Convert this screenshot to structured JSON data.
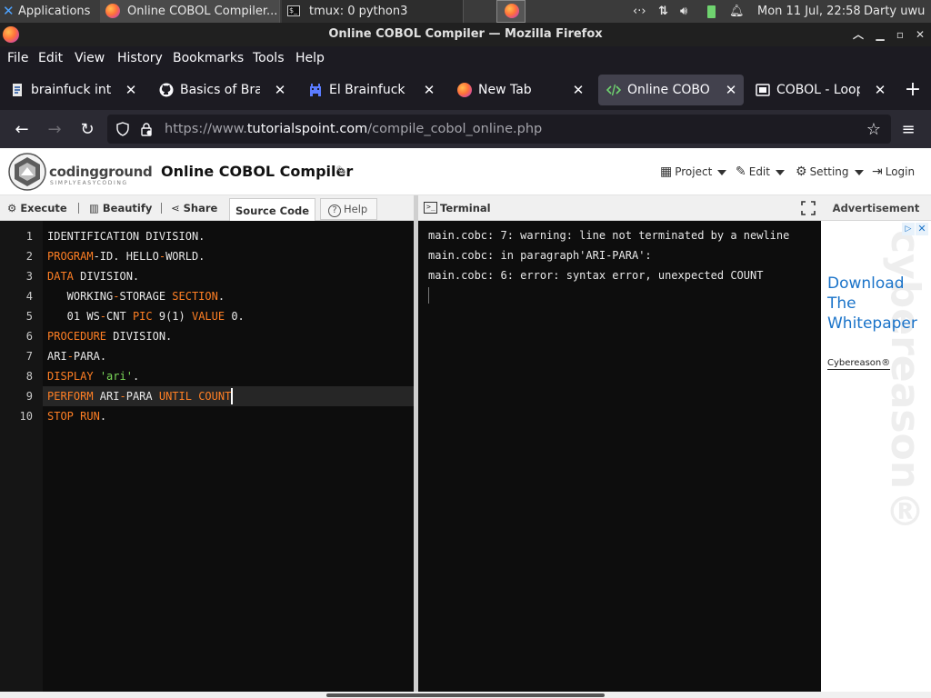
{
  "os_panel": {
    "apps_label": "Applications",
    "tasks": [
      "Online COBOL Compiler...",
      "tmux: 0 python3"
    ],
    "clock": "Mon 11 Jul, 22:58",
    "user": "Darty uwu"
  },
  "window": {
    "title": "Online COBOL Compiler — Mozilla Firefox"
  },
  "menubar": [
    "File",
    "Edit",
    "View",
    "History",
    "Bookmarks",
    "Tools",
    "Help"
  ],
  "tabs": [
    {
      "label": "brainfuck interp",
      "icon": "document-icon"
    },
    {
      "label": "Basics of BrainF",
      "icon": "github-icon"
    },
    {
      "label": "El Brainfuck",
      "icon": "invader-icon"
    },
    {
      "label": "New Tab",
      "icon": "firefox-icon"
    },
    {
      "label": "Online COBOL C",
      "icon": "code-icon",
      "active": true
    },
    {
      "label": "COBOL - Loop S",
      "icon": "tutorialspoint-icon"
    }
  ],
  "url": {
    "prefix": "https://www.",
    "domain": "tutorialspoint.com",
    "path": "/compile_cobol_online.php"
  },
  "site": {
    "logo_text": "codingground",
    "logo_sub": "SIMPLYEASYCODING",
    "page_title": "Online COBOL Compiler",
    "menu": {
      "project": "Project",
      "edit": "Edit",
      "setting": "Setting",
      "login": "Login"
    }
  },
  "toolbar": {
    "execute": "Execute",
    "beautify": "Beautify",
    "share": "Share",
    "source_code": "Source Code",
    "help": "Help"
  },
  "editor": {
    "active_line": 9,
    "lines": [
      [
        {
          "t": "IDENTIFICATION DIVISION."
        }
      ],
      [
        {
          "t": "PROGRAM",
          "c": "kw"
        },
        {
          "t": "-ID. HELLO"
        },
        {
          "t": "-",
          "c": "kw"
        },
        {
          "t": "WORLD."
        }
      ],
      [
        {
          "t": "DATA",
          "c": "kw"
        },
        {
          "t": " DIVISION."
        }
      ],
      [
        {
          "t": "   WORKING"
        },
        {
          "t": "-",
          "c": "kw"
        },
        {
          "t": "STORAGE "
        },
        {
          "t": "SECTION",
          "c": "kw"
        },
        {
          "t": "."
        }
      ],
      [
        {
          "t": "   01 WS"
        },
        {
          "t": "-",
          "c": "kw"
        },
        {
          "t": "CNT "
        },
        {
          "t": "PIC",
          "c": "kw"
        },
        {
          "t": " 9(1) "
        },
        {
          "t": "VALUE",
          "c": "kw"
        },
        {
          "t": " 0."
        }
      ],
      [
        {
          "t": "PROCEDURE",
          "c": "kw"
        },
        {
          "t": " DIVISION."
        }
      ],
      [
        {
          "t": "ARI"
        },
        {
          "t": "-",
          "c": "kw"
        },
        {
          "t": "PARA."
        }
      ],
      [
        {
          "t": "DISPLAY",
          "c": "kw"
        },
        {
          "t": " "
        },
        {
          "t": "'ari'",
          "c": "str"
        },
        {
          "t": "."
        }
      ],
      [
        {
          "t": "PERFORM",
          "c": "kw"
        },
        {
          "t": " ARI"
        },
        {
          "t": "-",
          "c": "kw"
        },
        {
          "t": "PARA "
        },
        {
          "t": "UNTIL",
          "c": "kw"
        },
        {
          "t": " "
        },
        {
          "t": "COUNT",
          "c": "kw"
        }
      ],
      [
        {
          "t": "STOP",
          "c": "kw"
        },
        {
          "t": " "
        },
        {
          "t": "RUN",
          "c": "kw"
        },
        {
          "t": "."
        }
      ]
    ]
  },
  "terminal": {
    "label": "Terminal",
    "lines": [
      "main.cobc: 7: warning: line not terminated by a newline",
      "main.cobc: in paragraph'ARI-PARA':",
      "main.cobc: 6: error: syntax error, unexpected COUNT"
    ]
  },
  "ad": {
    "header": "Advertisement",
    "headline": "Download The Whitepaper",
    "brand": "Cybereason®",
    "watermark": "cybereason®"
  }
}
